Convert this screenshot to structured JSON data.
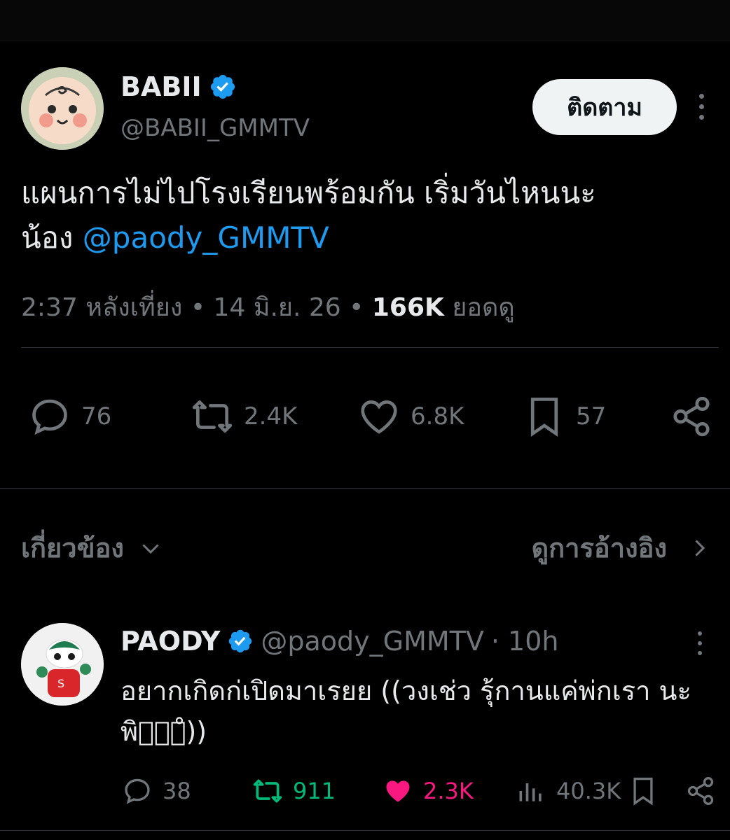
{
  "tweet": {
    "display_name": "BABII",
    "handle": "@BABII_GMMTV",
    "follow_label": "ติดตาม",
    "text_line1": "แผนการไม่ไปโรงเรียนพร้อมกัน เริ่มวันไหนนะ",
    "text_line2_prefix": "น้อง ",
    "mention": "@paody_GMMTV",
    "time": "2:37 หลังเที่ยง",
    "sep": " • ",
    "date": "14 มิ.ย. 26",
    "views_count": "166K",
    "views_label": " ยอดดู",
    "stats": {
      "replies": "76",
      "reposts": "2.4K",
      "likes": "6.8K",
      "bookmarks": "57"
    }
  },
  "related": {
    "label": "เกี่ยวข้อง",
    "quotes_link": "ดูการอ้างอิง"
  },
  "reply": {
    "display_name": "PAODY",
    "handle": "@paody_GMMTV",
    "time": "· 10h",
    "text": "อยากเกิดก่เปิดมาเรยย ((วงเช่ว รุ้กานแค่พ่กเรา นะพิบี่̊))",
    "stats": {
      "replies": "38",
      "reposts": "911",
      "likes": "2.3K",
      "views": "40.3K"
    }
  },
  "colors": {
    "background": "#000000",
    "primary_text": "#e7e9ea",
    "secondary_text": "#71767b",
    "link": "#1d9bf0",
    "verified": "#1d9bf0",
    "repost_active": "#00ba7c",
    "like_active": "#f91880"
  },
  "icons": [
    "verified-badge-icon",
    "more-icon",
    "reply-icon",
    "repost-icon",
    "like-icon",
    "bookmark-icon",
    "share-icon",
    "chevron-down-icon",
    "chevron-right-icon",
    "views-icon"
  ]
}
